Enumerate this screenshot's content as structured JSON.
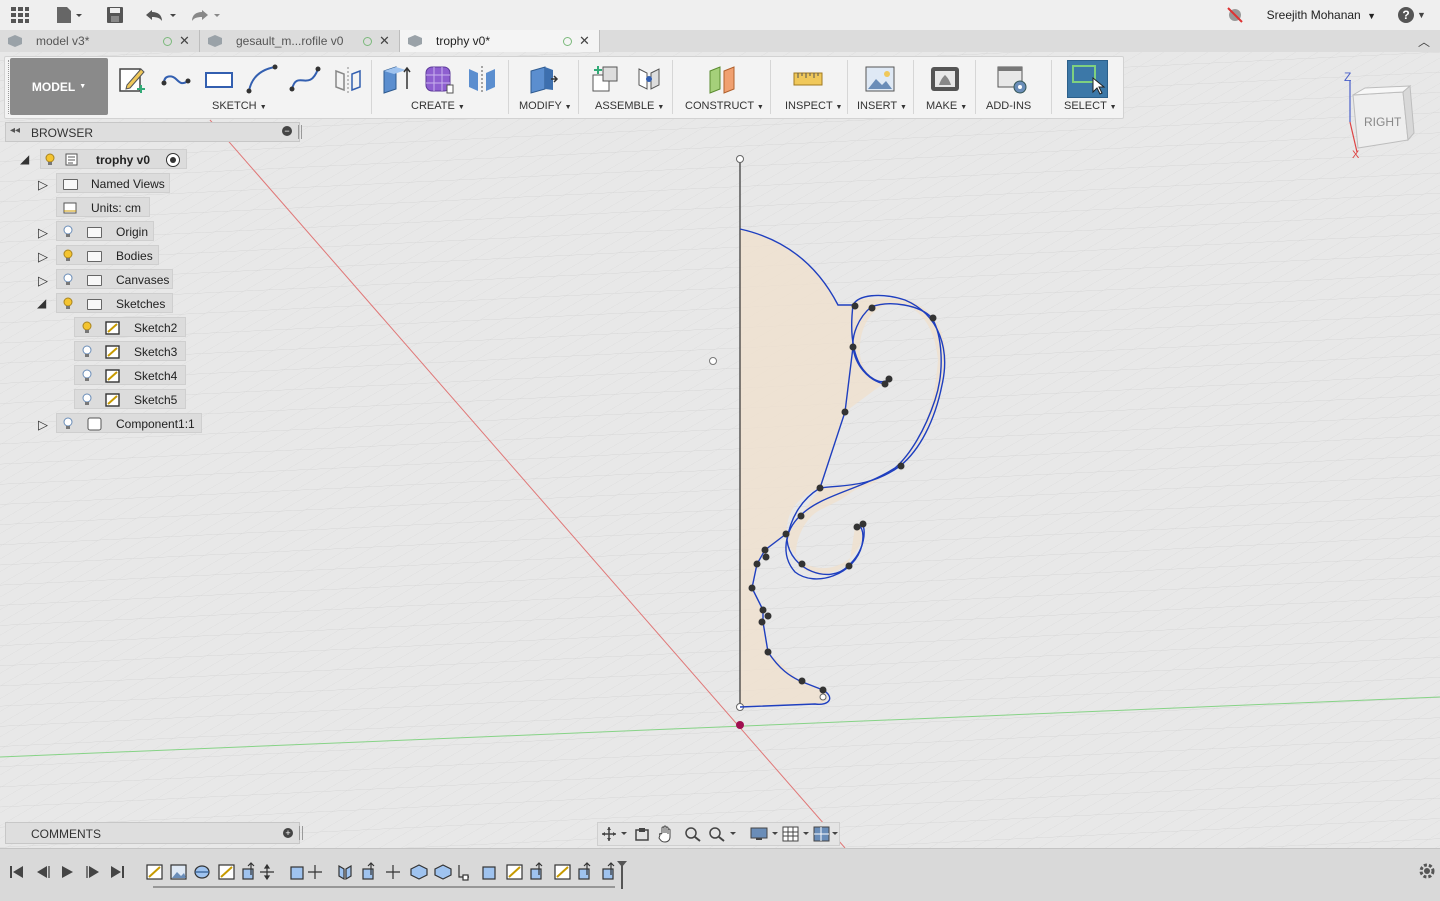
{
  "app": {
    "user_name": "Sreejith Mohanan",
    "help_label": "?"
  },
  "tabs": [
    {
      "label": "model v3*",
      "active": false
    },
    {
      "label": "gesault_m...rofile v0",
      "active": false
    },
    {
      "label": "trophy v0*",
      "active": true
    }
  ],
  "toolbar": {
    "mode": "MODEL",
    "groups": [
      "SKETCH",
      "CREATE",
      "MODIFY",
      "ASSEMBLE",
      "CONSTRUCT",
      "INSPECT",
      "INSERT",
      "MAKE",
      "ADD-INS",
      "SELECT"
    ]
  },
  "browser": {
    "title": "BROWSER",
    "root": "trophy v0",
    "items": [
      {
        "label": "Named Views"
      },
      {
        "label": "Units: cm"
      },
      {
        "label": "Origin"
      },
      {
        "label": "Bodies"
      },
      {
        "label": "Canvases"
      },
      {
        "label": "Sketches"
      },
      {
        "label": "Sketch2"
      },
      {
        "label": "Sketch3"
      },
      {
        "label": "Sketch4"
      },
      {
        "label": "Sketch5"
      },
      {
        "label": "Component1:1"
      }
    ]
  },
  "viewcube": {
    "face": "RIGHT",
    "axis_z": "Z",
    "axis_x": "X"
  },
  "comments": {
    "title": "COMMENTS"
  },
  "colors": {
    "sketch_line": "#1f3fbf",
    "profile_fill": "#efe1cf",
    "accent_select": "#3c78a8",
    "axis_red": "#e06060",
    "axis_green": "#7ed17e"
  }
}
